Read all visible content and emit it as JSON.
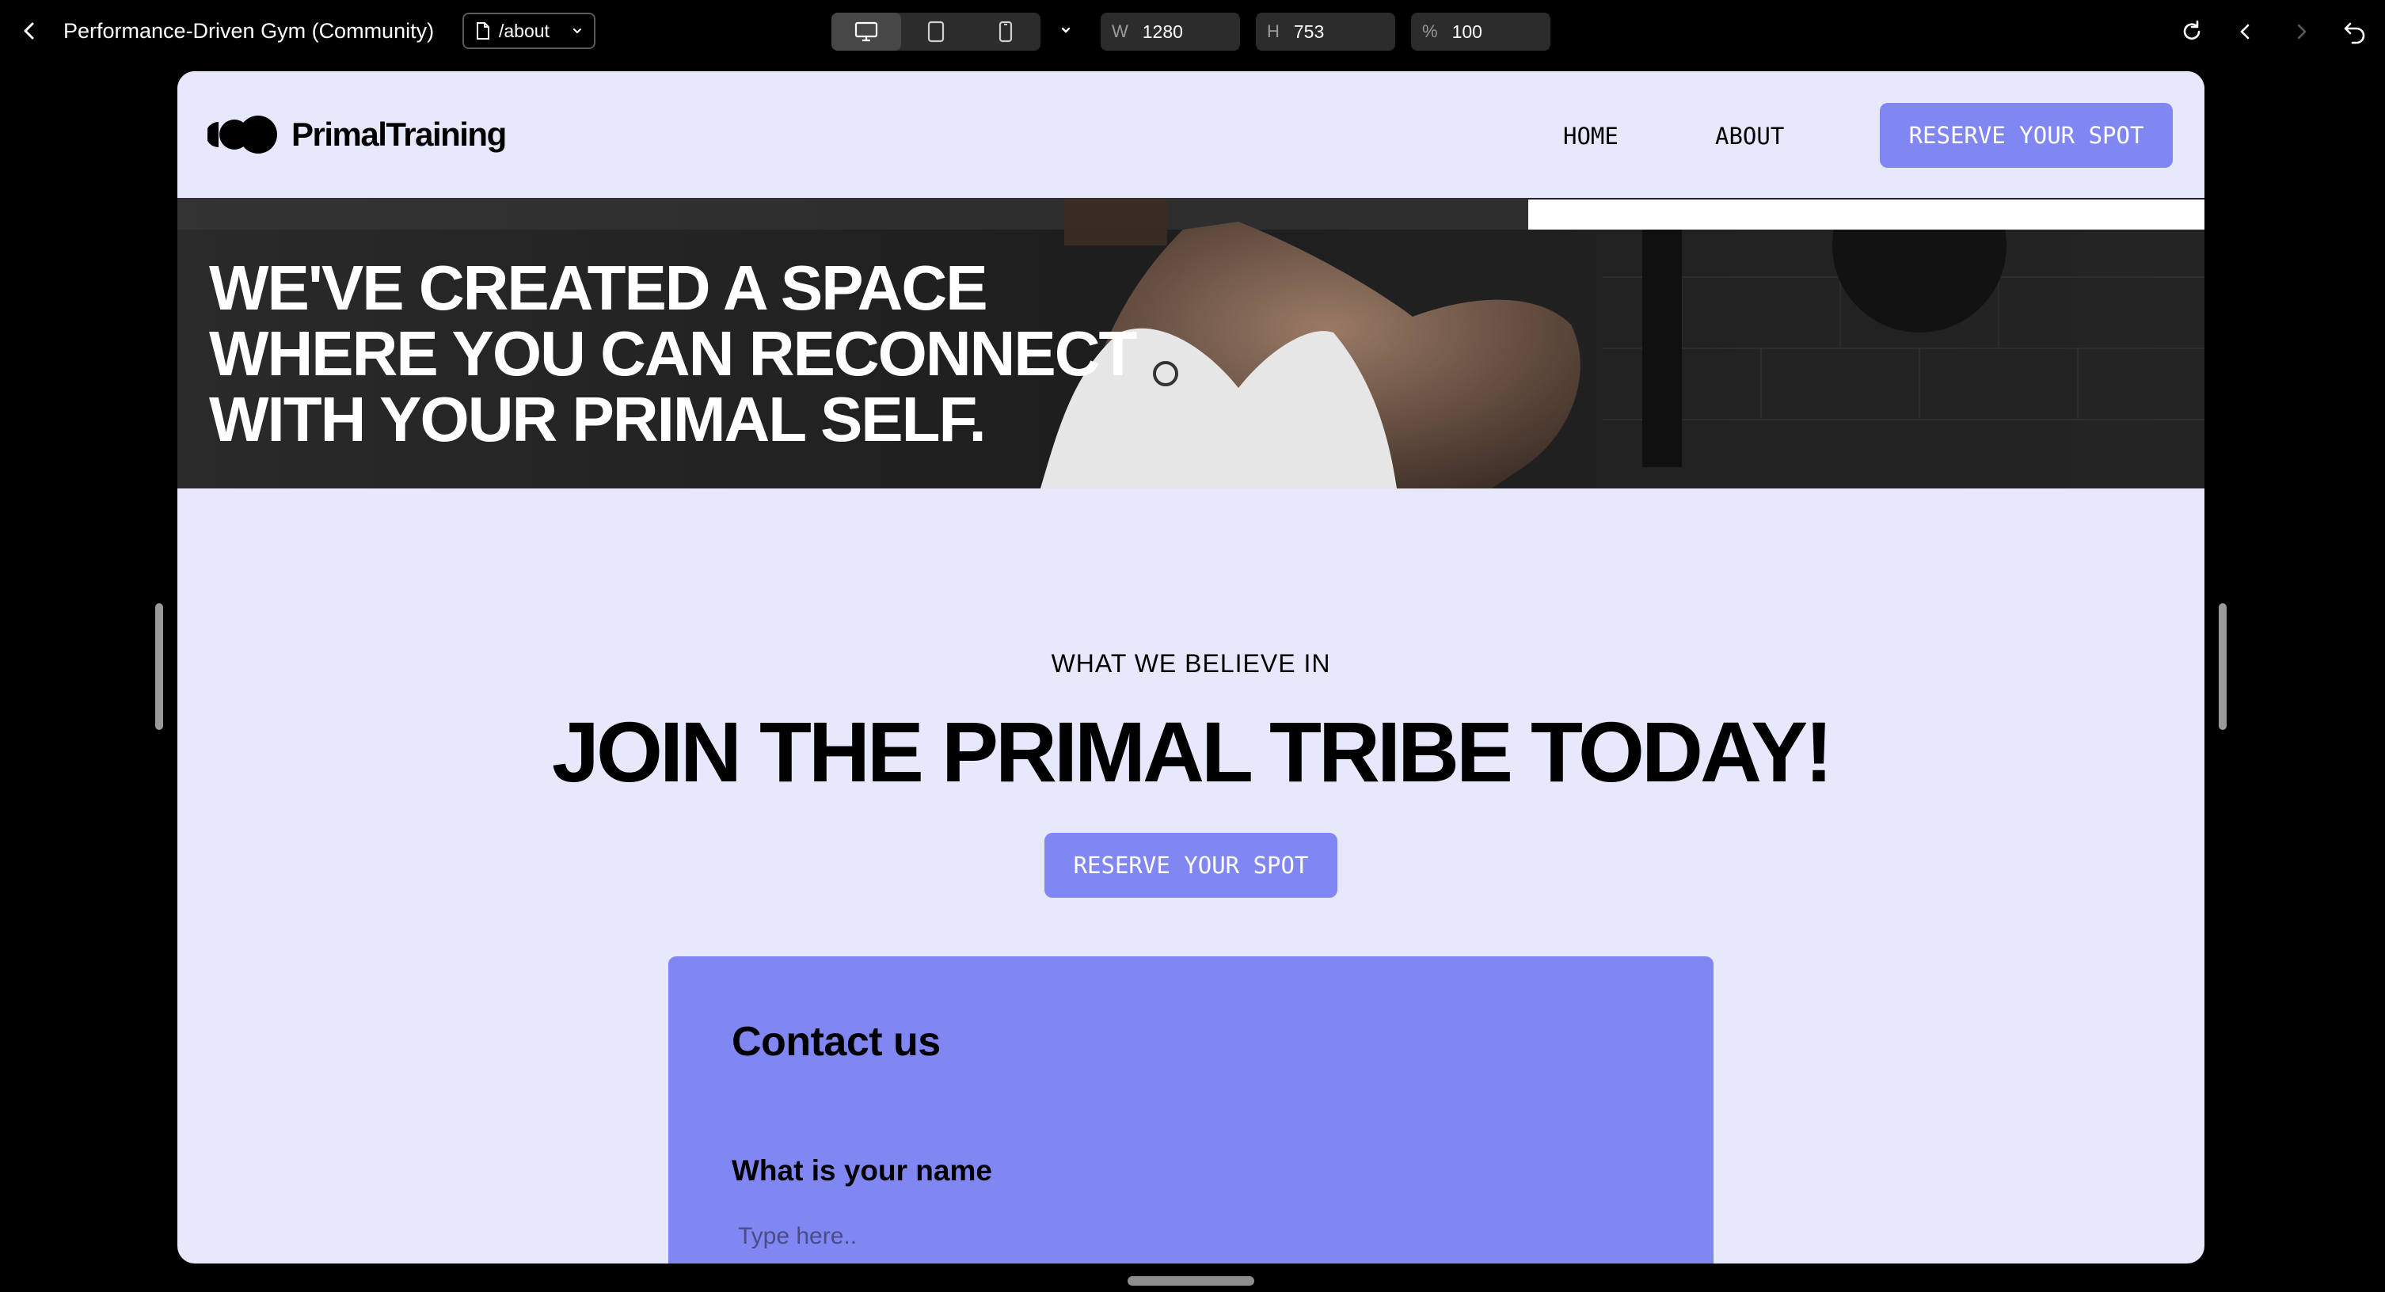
{
  "editor": {
    "project_title": "Performance-Driven Gym (Community)",
    "page_path": "/about",
    "width_label": "W",
    "width_value": "1280",
    "height_label": "H",
    "height_value": "753",
    "zoom_label": "%",
    "zoom_value": "100",
    "devices": [
      "desktop-icon",
      "tablet-icon",
      "phone-icon"
    ],
    "active_device": "desktop"
  },
  "site": {
    "brand": "PrimalTraining",
    "nav": [
      {
        "label": "HOME"
      },
      {
        "label": "ABOUT"
      }
    ],
    "nav_cta": "RESERVE YOUR SPOT",
    "hero": {
      "line1": "WE'VE CREATED A SPACE",
      "line2": "WHERE YOU CAN RECONNECT",
      "line3": "WITH YOUR PRIMAL SELF."
    },
    "eyebrow": "WHAT WE BELIEVE IN",
    "headline": "JOIN THE PRIMAL TRIBE TODAY!",
    "cta": "RESERVE YOUR SPOT",
    "contact": {
      "title": "Contact us",
      "name_label": "What is your name",
      "name_placeholder": "Type here.."
    }
  },
  "colors": {
    "page_bg": "#e8e8fc",
    "accent": "#8187f2",
    "text": "#000000"
  }
}
